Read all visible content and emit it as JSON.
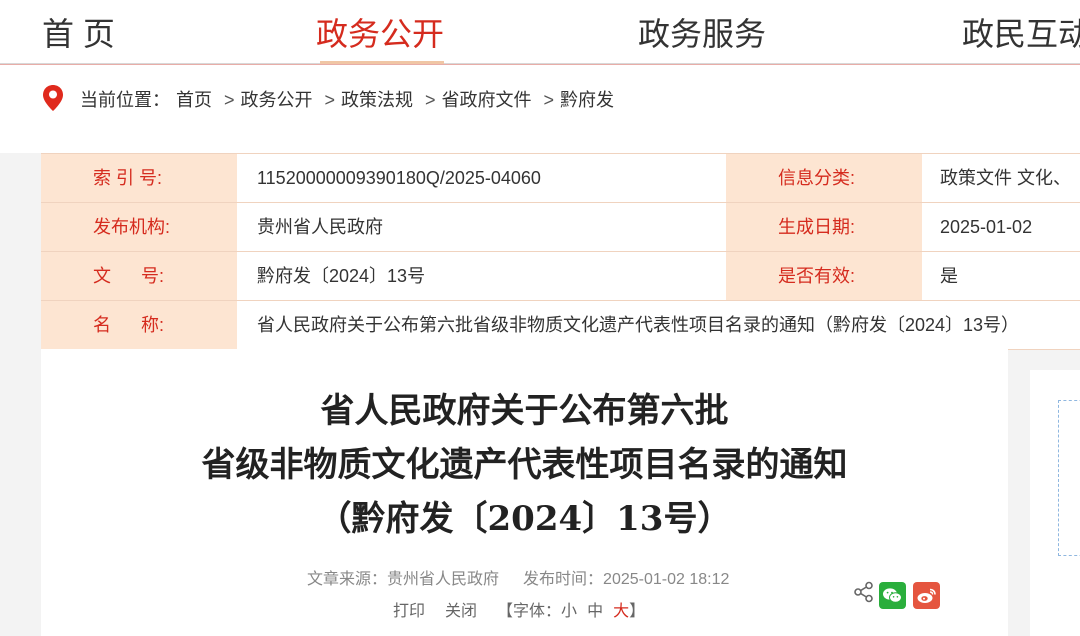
{
  "nav": {
    "items": [
      {
        "label": "首  页",
        "active": false
      },
      {
        "label": "政务公开",
        "active": true
      },
      {
        "label": "政务服务",
        "active": false
      },
      {
        "label": "政民互动",
        "active": false
      }
    ]
  },
  "breadcrumb": {
    "prefix": "当前位置：",
    "items": [
      "首页",
      "政务公开",
      "政策法规",
      "省政府文件",
      "黔府发"
    ],
    "separator": ">"
  },
  "info": {
    "index_label": "索 引 号:",
    "index_value": "11520000009390180Q/2025-04060",
    "category_label": "信息分类:",
    "category_value": "政策文件     文化、",
    "issuer_label": "发布机构:",
    "issuer_value": "贵州省人民政府",
    "date_label": "生成日期:",
    "date_value": "2025-01-02",
    "docno_label": "文      号:",
    "docno_value": "黔府发〔2024〕13号",
    "valid_label": "是否有效:",
    "valid_value": "是",
    "name_label": "名      称:",
    "name_value": "省人民政府关于公布第六批省级非物质文化遗产代表性项目名录的通知（黔府发〔2024〕13号）"
  },
  "article": {
    "title_line1": "省人民政府关于公布第六批",
    "title_line2": "省级非物质文化遗产代表性项目名录的通知",
    "title_line3": "（黔府发〔2024〕13号）",
    "source_label": "文章来源：",
    "source_value": "贵州省人民政府",
    "time_label": "发布时间：",
    "time_value": "2025-01-02 18:12",
    "print_label": "打印",
    "close_label": "关闭",
    "font_prefix": "【字体：",
    "font_small": "小",
    "font_medium": "中",
    "font_large": "大",
    "font_suffix": "】"
  },
  "colors": {
    "accent": "#d52b1e",
    "label_bg": "#fde5d2",
    "wechat": "#2aae3c",
    "weibo": "#e5553f"
  }
}
